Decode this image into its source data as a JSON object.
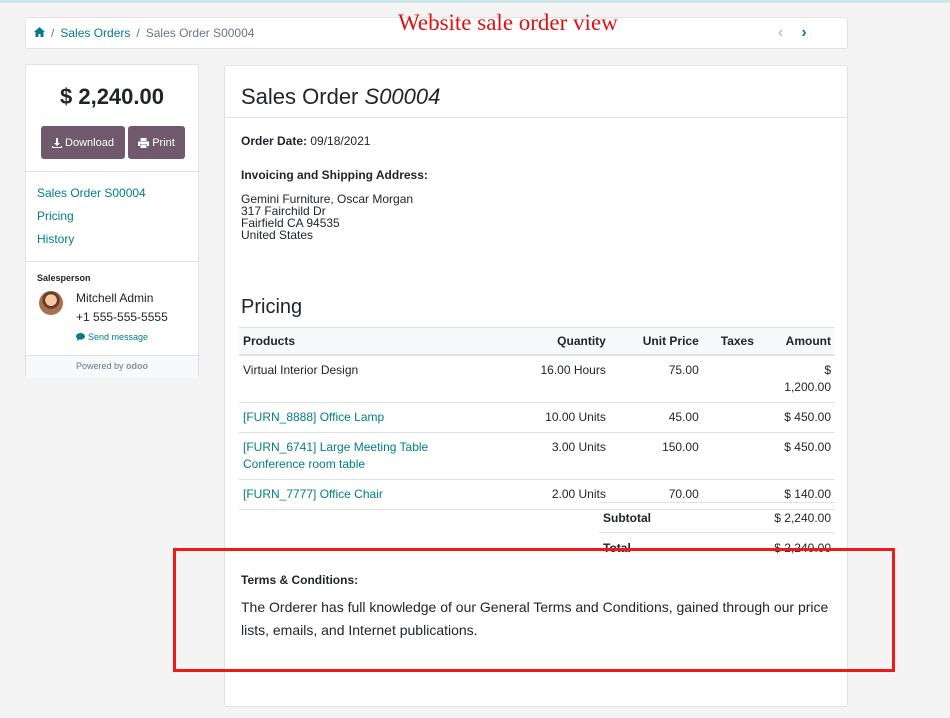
{
  "annotation": "Website sale order view",
  "breadcrumb": {
    "items": [
      "Sales Orders",
      "Sales Order S00004"
    ]
  },
  "pager": {
    "prev": "‹",
    "next": "›"
  },
  "sidebar": {
    "amount": "$ 2,240.00",
    "download_label": "Download",
    "print_label": "Print",
    "nav": [
      "Sales Order S00004",
      "Pricing",
      "History"
    ],
    "salesperson_label": "Salesperson",
    "salesperson_name": "Mitchell Admin",
    "salesperson_phone": "+1 555-555-5555",
    "send_message": "Send message",
    "powered_by": "Powered by",
    "powered_brand": "odoo"
  },
  "order": {
    "title_prefix": "Sales Order",
    "number": "S00004",
    "order_date_label": "Order Date:",
    "order_date": "09/18/2021",
    "address_label": "Invoicing and Shipping Address:",
    "address_lines": [
      "Gemini Furniture, Oscar Morgan",
      "317 Fairchild Dr",
      "Fairfield CA 94535",
      "United States"
    ],
    "pricing_title": "Pricing",
    "columns": [
      "Products",
      "Quantity",
      "Unit Price",
      "Taxes",
      "Amount"
    ],
    "lines": [
      {
        "product": "Virtual Interior Design",
        "description": "",
        "quantity": "16.00 Hours",
        "unit_price": "75.00",
        "taxes": "",
        "amount": "$ 1,200.00",
        "link": false
      },
      {
        "product": "[FURN_8888] Office Lamp",
        "description": "",
        "quantity": "10.00 Units",
        "unit_price": "45.00",
        "taxes": "",
        "amount": "$ 450.00",
        "link": true
      },
      {
        "product": "[FURN_6741] Large Meeting Table",
        "description": "Conference room table",
        "quantity": "3.00 Units",
        "unit_price": "150.00",
        "taxes": "",
        "amount": "$ 450.00",
        "link": true
      },
      {
        "product": "[FURN_7777] Office Chair",
        "description": "",
        "quantity": "2.00 Units",
        "unit_price": "70.00",
        "taxes": "",
        "amount": "$ 140.00",
        "link": true
      }
    ],
    "subtotal_label": "Subtotal",
    "subtotal": "$ 2,240.00",
    "total_label": "Total",
    "total": "$ 2,240.00",
    "terms_title": "Terms & Conditions:",
    "terms_text": "The Orderer has full knowledge of our General Terms and Conditions, gained through our price lists, emails, and Internet publications."
  }
}
